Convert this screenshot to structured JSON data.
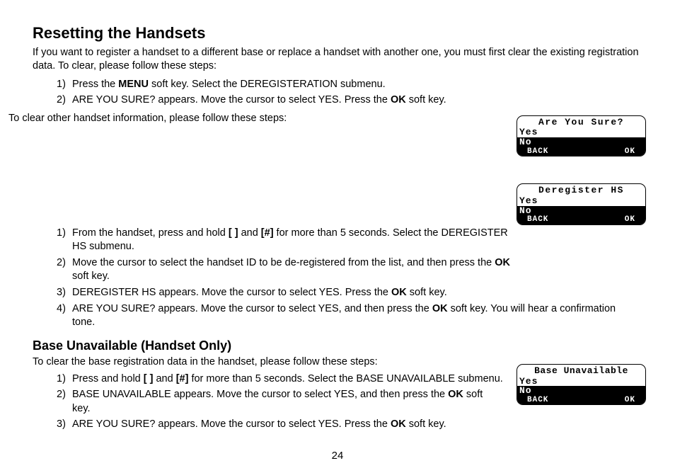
{
  "heading1": "Resetting the Handsets",
  "intro1a": "If you want to register a handset to a different base or replace a handset with another one, you must first clear the existing registration data. To clear, please follow these steps:",
  "steps1": [
    {
      "n": "1)",
      "pre": "Press the ",
      "bold1": "MENU",
      "mid": " soft key. Select the DEREGISTERATION submenu."
    },
    {
      "n": "2)",
      "pre": "ARE YOU SURE? appears. Move the cursor to select YES. Press the ",
      "bold1": "OK",
      "mid": " soft key."
    }
  ],
  "intro1b": "To clear other handset information, please follow these steps:",
  "steps2": [
    {
      "n": "1)",
      "pre": "From the handset, press and hold ",
      "bold1": "[ ]",
      "mid": " and ",
      "bold2": "[#]",
      "post": " for more than 5 seconds. Select the DEREGISTER HS submenu."
    },
    {
      "n": "2)",
      "pre": "Move the cursor to select the handset ID to be de-registered from the list, and then press the ",
      "bold1": "OK",
      "mid": " soft key."
    },
    {
      "n": "3)",
      "pre": "DEREGISTER HS appears. Move the cursor to select YES. Press the ",
      "bold1": "OK",
      "mid": " soft key."
    },
    {
      "n": "4)",
      "pre": "ARE YOU SURE? appears. Move the cursor to select YES, and then press the ",
      "bold1": "OK",
      "mid": " soft key. You will hear a confirmation tone."
    }
  ],
  "heading2": "Base Unavailable (Handset Only)",
  "intro2": "To clear the base registration data in the handset, please follow these steps:",
  "steps3": [
    {
      "n": "1)",
      "pre": "Press and hold ",
      "bold1": "[ ]",
      "mid": " and ",
      "bold2": "[#]",
      "post": " for more than 5 seconds. Select the BASE UNAVAIL­ABLE submenu."
    },
    {
      "n": "2)",
      "pre": "BASE UNAVAILABLE appears. Move the cursor to select YES, and then press the ",
      "bold1": "OK",
      "mid": " soft key."
    },
    {
      "n": "3)",
      "pre": "ARE YOU SURE? appears. Move the cursor to select YES. Press the ",
      "bold1": "OK",
      "mid": " soft key."
    }
  ],
  "lcd": {
    "yes": "Yes",
    "no": "No",
    "back": "BACK",
    "ok": "OK",
    "t1": "Are You Sure?",
    "t2": "Deregister HS",
    "t3": "Base Unavailable"
  },
  "page": "24"
}
